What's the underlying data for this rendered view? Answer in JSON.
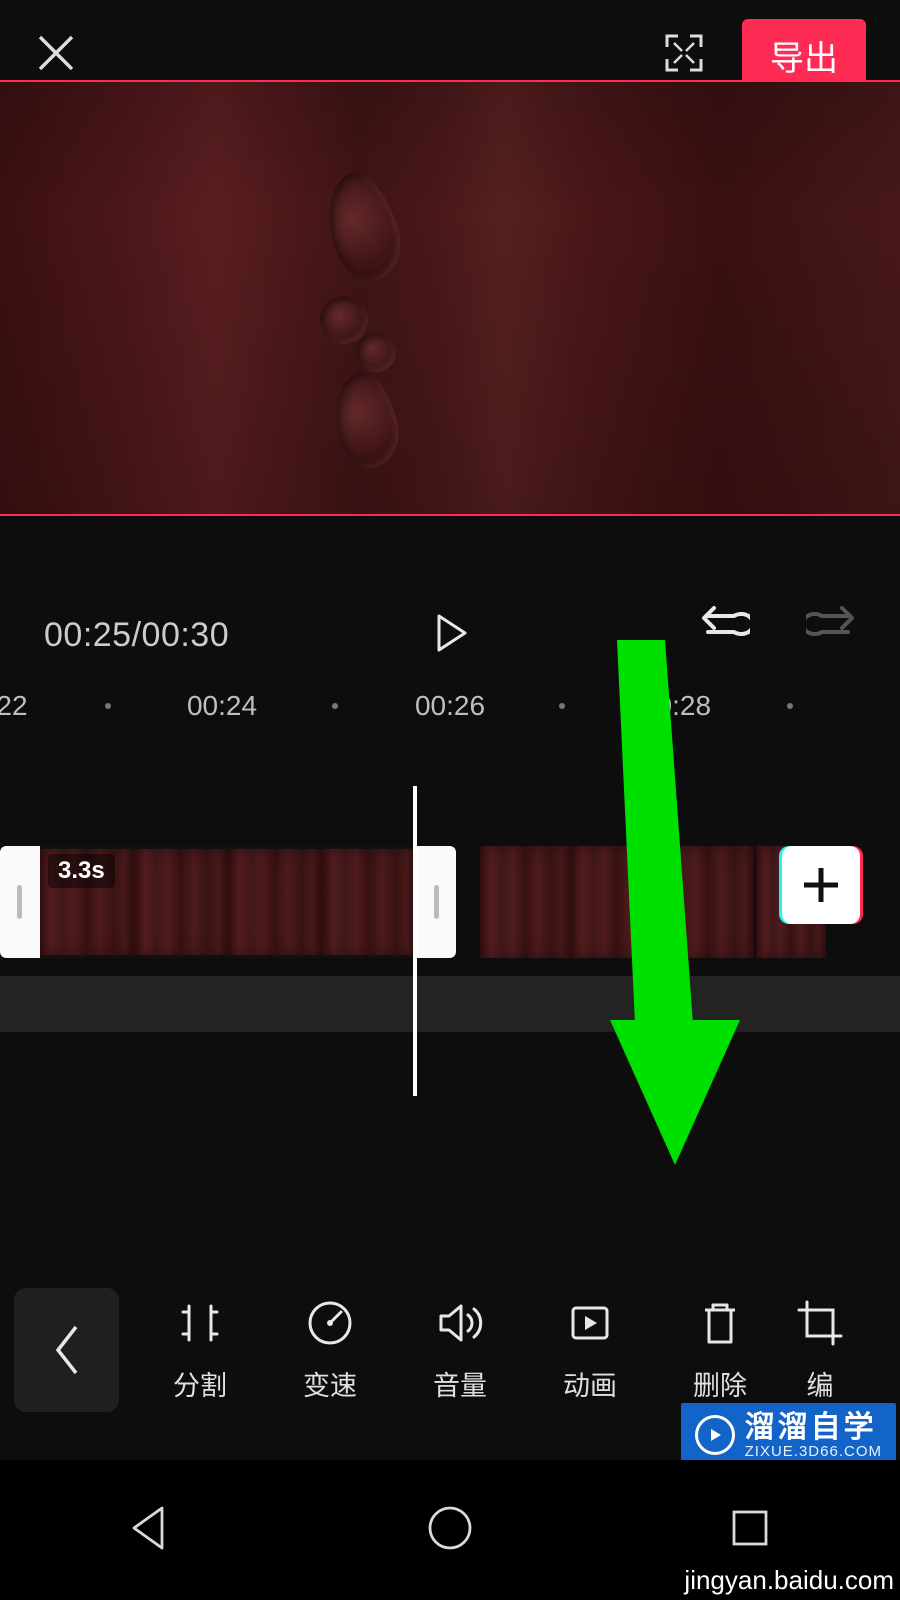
{
  "header": {
    "export_label": "导出"
  },
  "playback": {
    "time_display": "00:25/00:30"
  },
  "ruler": {
    "ticks": [
      {
        "type": "label",
        "pos": 12,
        "text": "22"
      },
      {
        "type": "dot",
        "pos": 108
      },
      {
        "type": "label",
        "pos": 222,
        "text": "00:24"
      },
      {
        "type": "dot",
        "pos": 335
      },
      {
        "type": "label",
        "pos": 450,
        "text": "00:26"
      },
      {
        "type": "dot",
        "pos": 562
      },
      {
        "type": "label",
        "pos": 676,
        "text": "00:28"
      },
      {
        "type": "dot",
        "pos": 790
      }
    ]
  },
  "timeline": {
    "selected_clip_duration": "3.3s"
  },
  "toolbar": {
    "items": [
      {
        "id": "split",
        "label": "分割",
        "icon": "split"
      },
      {
        "id": "speed",
        "label": "变速",
        "icon": "speed"
      },
      {
        "id": "volume",
        "label": "音量",
        "icon": "volume"
      },
      {
        "id": "anim",
        "label": "动画",
        "icon": "anim"
      },
      {
        "id": "delete",
        "label": "删除",
        "icon": "delete"
      },
      {
        "id": "edit",
        "label": "编",
        "icon": "crop",
        "partial": true
      }
    ]
  },
  "watermark": {
    "brand": "溜溜自学",
    "brand_sub": "ZIXUE.3D66.COM",
    "url": "jingyan.baidu.com"
  }
}
